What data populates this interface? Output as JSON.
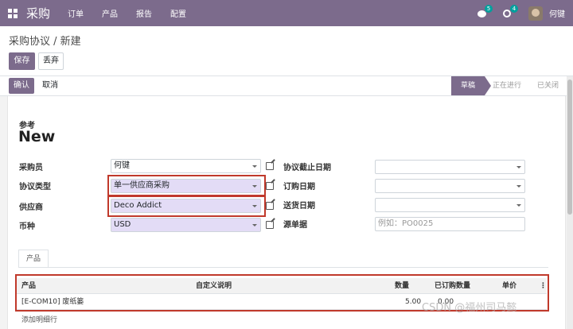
{
  "nav": {
    "brand": "采购",
    "menu": [
      "订单",
      "产品",
      "报告",
      "配置"
    ],
    "chat_count": "5",
    "activity_count": "4",
    "user_name": "何键"
  },
  "control": {
    "breadcrumb": "采购协议 / 新建",
    "save_label": "保存",
    "discard_label": "丢弃"
  },
  "statusbar": {
    "confirm_label": "确认",
    "cancel_label": "取消",
    "stages": [
      "草稿",
      "正在进行",
      "已关闭"
    ],
    "active_stage": "草稿"
  },
  "form": {
    "reference_label": "参考",
    "reference_value": "New",
    "buyer_label": "采购员",
    "buyer_value": "何键",
    "agreement_type_label": "协议类型",
    "agreement_type_value": "单一供应商采购",
    "vendor_label": "供应商",
    "vendor_value": "Deco Addict",
    "currency_label": "币种",
    "currency_value": "USD",
    "deadline_label": "协议截止日期",
    "order_date_label": "订购日期",
    "delivery_date_label": "送货日期",
    "source_label": "源单据",
    "source_placeholder": "例如：PO0025"
  },
  "lines": {
    "tab_label": "产品",
    "headers": [
      "产品",
      "自定义说明",
      "数量",
      "已订购数量",
      "单价"
    ],
    "rows": [
      {
        "product": "[E-COM10] 废纸篓",
        "description": "",
        "quantity": "5.00",
        "ordered": "0.00",
        "price": ""
      }
    ],
    "add_line_label": "添加明细行"
  },
  "watermark": "CSDN @福州司马懿",
  "colors": {
    "brand": "#7c6b8c",
    "highlight": "#c0392b",
    "field_purple": "#e3dcf6"
  }
}
